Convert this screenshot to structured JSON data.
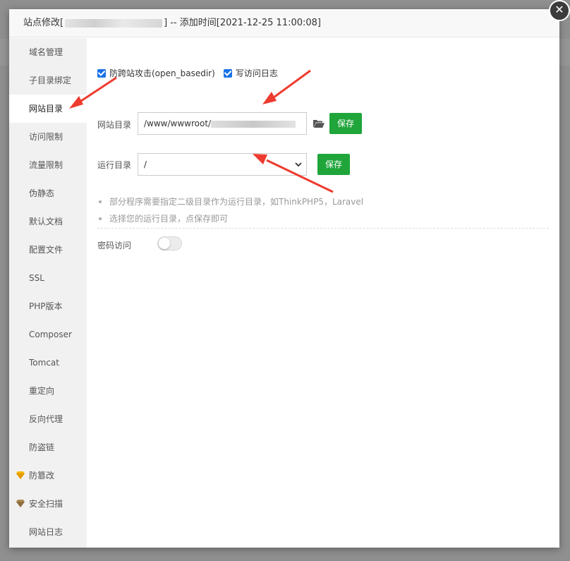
{
  "dialog": {
    "title_prefix": "站点修改[",
    "title_suffix": "] -- 添加时间[2021-12-25 11:00:08]",
    "close_symbol": "✕"
  },
  "sidebar": {
    "items": [
      {
        "label": "域名管理"
      },
      {
        "label": "子目录绑定"
      },
      {
        "label": "网站目录",
        "active": true
      },
      {
        "label": "访问限制"
      },
      {
        "label": "流量限制"
      },
      {
        "label": "伪静态"
      },
      {
        "label": "默认文档"
      },
      {
        "label": "配置文件"
      },
      {
        "label": "SSL"
      },
      {
        "label": "PHP版本"
      },
      {
        "label": "Composer"
      },
      {
        "label": "Tomcat"
      },
      {
        "label": "重定向"
      },
      {
        "label": "反向代理"
      },
      {
        "label": "防盗链"
      },
      {
        "label": "防篡改",
        "icon": "gem-gold-icon"
      },
      {
        "label": "安全扫描",
        "icon": "gem-bronze-icon"
      },
      {
        "label": "网站日志"
      }
    ]
  },
  "options": {
    "open_basedir": {
      "label": "防跨站攻击(open_basedir)",
      "checked": true
    },
    "access_log": {
      "label": "写访问日志",
      "checked": true
    }
  },
  "site_dir": {
    "label": "网站目录",
    "value": "/www/wwwroot/",
    "save_label": "保存"
  },
  "run_dir": {
    "label": "运行目录",
    "value": "/",
    "save_label": "保存"
  },
  "tips": [
    "部分程序需要指定二级目录作为运行目录，如ThinkPHP5，Laravel",
    "选择您的运行目录，点保存即可"
  ],
  "password_access": {
    "label": "密码访问",
    "enabled": false
  },
  "colors": {
    "save_button": "#20a53a",
    "checkbox": "#1a73e8",
    "annotation_arrow": "#ee3b2f"
  }
}
